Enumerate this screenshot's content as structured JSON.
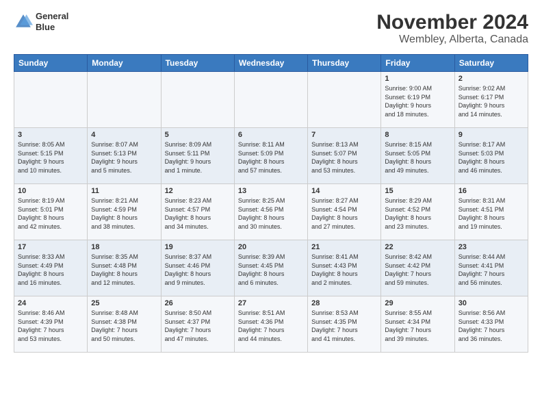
{
  "header": {
    "logo_line1": "General",
    "logo_line2": "Blue",
    "title": "November 2024",
    "subtitle": "Wembley, Alberta, Canada"
  },
  "days_of_week": [
    "Sunday",
    "Monday",
    "Tuesday",
    "Wednesday",
    "Thursday",
    "Friday",
    "Saturday"
  ],
  "weeks": [
    [
      {
        "day": "",
        "info": ""
      },
      {
        "day": "",
        "info": ""
      },
      {
        "day": "",
        "info": ""
      },
      {
        "day": "",
        "info": ""
      },
      {
        "day": "",
        "info": ""
      },
      {
        "day": "1",
        "info": "Sunrise: 9:00 AM\nSunset: 6:19 PM\nDaylight: 9 hours\nand 18 minutes."
      },
      {
        "day": "2",
        "info": "Sunrise: 9:02 AM\nSunset: 6:17 PM\nDaylight: 9 hours\nand 14 minutes."
      }
    ],
    [
      {
        "day": "3",
        "info": "Sunrise: 8:05 AM\nSunset: 5:15 PM\nDaylight: 9 hours\nand 10 minutes."
      },
      {
        "day": "4",
        "info": "Sunrise: 8:07 AM\nSunset: 5:13 PM\nDaylight: 9 hours\nand 5 minutes."
      },
      {
        "day": "5",
        "info": "Sunrise: 8:09 AM\nSunset: 5:11 PM\nDaylight: 9 hours\nand 1 minute."
      },
      {
        "day": "6",
        "info": "Sunrise: 8:11 AM\nSunset: 5:09 PM\nDaylight: 8 hours\nand 57 minutes."
      },
      {
        "day": "7",
        "info": "Sunrise: 8:13 AM\nSunset: 5:07 PM\nDaylight: 8 hours\nand 53 minutes."
      },
      {
        "day": "8",
        "info": "Sunrise: 8:15 AM\nSunset: 5:05 PM\nDaylight: 8 hours\nand 49 minutes."
      },
      {
        "day": "9",
        "info": "Sunrise: 8:17 AM\nSunset: 5:03 PM\nDaylight: 8 hours\nand 46 minutes."
      }
    ],
    [
      {
        "day": "10",
        "info": "Sunrise: 8:19 AM\nSunset: 5:01 PM\nDaylight: 8 hours\nand 42 minutes."
      },
      {
        "day": "11",
        "info": "Sunrise: 8:21 AM\nSunset: 4:59 PM\nDaylight: 8 hours\nand 38 minutes."
      },
      {
        "day": "12",
        "info": "Sunrise: 8:23 AM\nSunset: 4:57 PM\nDaylight: 8 hours\nand 34 minutes."
      },
      {
        "day": "13",
        "info": "Sunrise: 8:25 AM\nSunset: 4:56 PM\nDaylight: 8 hours\nand 30 minutes."
      },
      {
        "day": "14",
        "info": "Sunrise: 8:27 AM\nSunset: 4:54 PM\nDaylight: 8 hours\nand 27 minutes."
      },
      {
        "day": "15",
        "info": "Sunrise: 8:29 AM\nSunset: 4:52 PM\nDaylight: 8 hours\nand 23 minutes."
      },
      {
        "day": "16",
        "info": "Sunrise: 8:31 AM\nSunset: 4:51 PM\nDaylight: 8 hours\nand 19 minutes."
      }
    ],
    [
      {
        "day": "17",
        "info": "Sunrise: 8:33 AM\nSunset: 4:49 PM\nDaylight: 8 hours\nand 16 minutes."
      },
      {
        "day": "18",
        "info": "Sunrise: 8:35 AM\nSunset: 4:48 PM\nDaylight: 8 hours\nand 12 minutes."
      },
      {
        "day": "19",
        "info": "Sunrise: 8:37 AM\nSunset: 4:46 PM\nDaylight: 8 hours\nand 9 minutes."
      },
      {
        "day": "20",
        "info": "Sunrise: 8:39 AM\nSunset: 4:45 PM\nDaylight: 8 hours\nand 6 minutes."
      },
      {
        "day": "21",
        "info": "Sunrise: 8:41 AM\nSunset: 4:43 PM\nDaylight: 8 hours\nand 2 minutes."
      },
      {
        "day": "22",
        "info": "Sunrise: 8:42 AM\nSunset: 4:42 PM\nDaylight: 7 hours\nand 59 minutes."
      },
      {
        "day": "23",
        "info": "Sunrise: 8:44 AM\nSunset: 4:41 PM\nDaylight: 7 hours\nand 56 minutes."
      }
    ],
    [
      {
        "day": "24",
        "info": "Sunrise: 8:46 AM\nSunset: 4:39 PM\nDaylight: 7 hours\nand 53 minutes."
      },
      {
        "day": "25",
        "info": "Sunrise: 8:48 AM\nSunset: 4:38 PM\nDaylight: 7 hours\nand 50 minutes."
      },
      {
        "day": "26",
        "info": "Sunrise: 8:50 AM\nSunset: 4:37 PM\nDaylight: 7 hours\nand 47 minutes."
      },
      {
        "day": "27",
        "info": "Sunrise: 8:51 AM\nSunset: 4:36 PM\nDaylight: 7 hours\nand 44 minutes."
      },
      {
        "day": "28",
        "info": "Sunrise: 8:53 AM\nSunset: 4:35 PM\nDaylight: 7 hours\nand 41 minutes."
      },
      {
        "day": "29",
        "info": "Sunrise: 8:55 AM\nSunset: 4:34 PM\nDaylight: 7 hours\nand 39 minutes."
      },
      {
        "day": "30",
        "info": "Sunrise: 8:56 AM\nSunset: 4:33 PM\nDaylight: 7 hours\nand 36 minutes."
      }
    ]
  ]
}
